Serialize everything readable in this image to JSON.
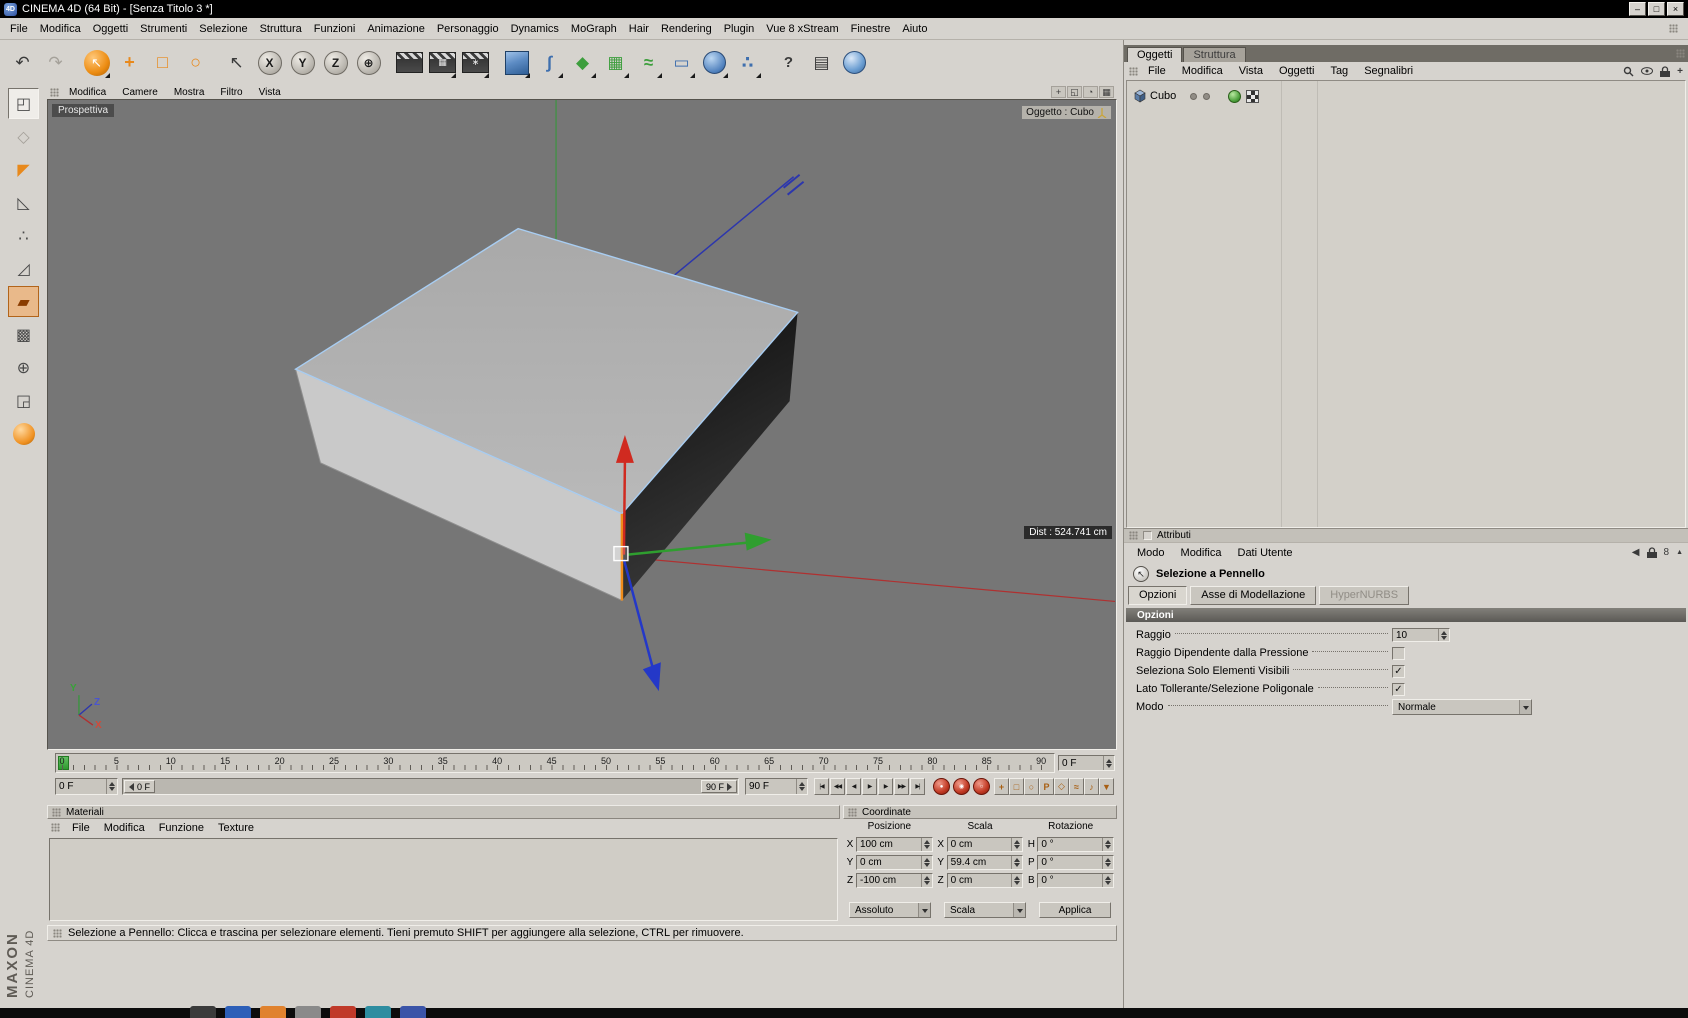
{
  "titlebar": {
    "app_badge": "4D",
    "title": "CINEMA 4D (64 Bit) - [Senza Titolo 3 *]",
    "min": "–",
    "max": "□",
    "close": "×"
  },
  "menubar": [
    "File",
    "Modifica",
    "Oggetti",
    "Strumenti",
    "Selezione",
    "Struttura",
    "Funzioni",
    "Animazione",
    "Personaggio",
    "Dynamics",
    "MoGraph",
    "Hair",
    "Rendering",
    "Plugin",
    "Vue 8 xStream",
    "Finestre",
    "Aiuto"
  ],
  "toolbar": [
    {
      "name": "undo-button",
      "glyph": "↶"
    },
    {
      "name": "redo-button",
      "glyph": "↷",
      "cls": "t-dim"
    },
    {
      "sep": true
    },
    {
      "name": "live-selection-tool",
      "glyph": "↖",
      "cls": "t-circle",
      "dd": true
    },
    {
      "name": "move-tool",
      "glyph": "+",
      "cls": "t-orange"
    },
    {
      "name": "scale-tool",
      "glyph": "□",
      "cls": "t-orange"
    },
    {
      "name": "rotate-tool",
      "glyph": "○",
      "cls": "t-orange"
    },
    {
      "sep": true
    },
    {
      "name": "last-used-tool",
      "glyph": "↖"
    },
    {
      "name": "lock-x-axis-button",
      "glyph": "X",
      "cls": "t-axis"
    },
    {
      "name": "lock-y-axis-button",
      "glyph": "Y",
      "cls": "t-axis"
    },
    {
      "name": "lock-z-axis-button",
      "glyph": "Z",
      "cls": "t-axis"
    },
    {
      "name": "coordinate-system-button",
      "glyph": "⊕",
      "cls": "t-axis"
    },
    {
      "sep": true
    },
    {
      "name": "render-view-button",
      "glyph": "",
      "cls": "t-clap"
    },
    {
      "name": "render-picture-viewer-button",
      "glyph": "▦",
      "cls": "t-clap",
      "dd": true
    },
    {
      "name": "render-settings-button",
      "glyph": "∗",
      "cls": "t-clap",
      "dd": true
    },
    {
      "sep": true
    },
    {
      "name": "add-cube-button",
      "glyph": "",
      "cls": "t-cube",
      "dd": true
    },
    {
      "name": "add-spline-button",
      "glyph": "∫",
      "cls": "t-blue",
      "dd": true
    },
    {
      "name": "add-nurbs-button",
      "glyph": "◆",
      "cls": "t-green",
      "dd": true
    },
    {
      "name": "add-modeling-object-button",
      "glyph": "▦",
      "cls": "t-green",
      "dd": true
    },
    {
      "name": "add-deformer-button",
      "glyph": "≈",
      "cls": "t-green",
      "dd": true
    },
    {
      "name": "add-scene-object-button",
      "glyph": "▭",
      "cls": "t-blue",
      "dd": true
    },
    {
      "name": "add-environment-button",
      "glyph": "",
      "cls": "t-ball",
      "dd": true
    },
    {
      "name": "add-particles-button",
      "glyph": "∴",
      "cls": "t-blue",
      "dd": true
    },
    {
      "sep": true
    },
    {
      "name": "help-button",
      "glyph": "?",
      "cls": "t-help"
    },
    {
      "name": "edit-layout-button",
      "glyph": "▤"
    },
    {
      "name": "online-help-button",
      "glyph": "",
      "cls": "t-globe"
    }
  ],
  "left_toolbar": [
    {
      "name": "make-editable-button",
      "glyph": "◰",
      "cls": "l-active"
    },
    {
      "name": "model-mode-button",
      "glyph": "◇",
      "cls": "l-dim"
    },
    {
      "name": "texture-axis-mode-button",
      "glyph": "◤",
      "cls": "l-orange"
    },
    {
      "name": "workplane-mode-button",
      "glyph": "◺"
    },
    {
      "name": "points-mode-button",
      "glyph": "∴"
    },
    {
      "name": "edges-mode-button",
      "glyph": "◿"
    },
    {
      "name": "polygons-mode-button",
      "glyph": "▰",
      "cls": "l-poly"
    },
    {
      "name": "texture-mode-button",
      "glyph": "▩"
    },
    {
      "name": "object-axis-mode-button",
      "glyph": "⊕"
    },
    {
      "name": "uv-mode-button",
      "glyph": "◲"
    },
    {
      "name": "render-region-button",
      "glyph": "",
      "cls": "l-ball"
    }
  ],
  "viewport": {
    "menu": [
      "Modifica",
      "Camere",
      "Mostra",
      "Filtro",
      "Vista"
    ],
    "nav_icons": [
      {
        "name": "view-pan-icon",
        "glyph": "+"
      },
      {
        "name": "view-zoom-icon",
        "glyph": "◱"
      },
      {
        "name": "view-rotate-icon",
        "glyph": "◔"
      },
      {
        "name": "view-switch-icon",
        "glyph": "▦"
      }
    ],
    "view_label": "Prospettiva",
    "object_label": "Oggetto : Cubo",
    "dist_label": "Dist : 524.741 cm",
    "axis": {
      "x": "X",
      "y": "Y",
      "z": "Z"
    }
  },
  "timeline": {
    "ticks": [
      0,
      5,
      10,
      15,
      20,
      25,
      30,
      35,
      40,
      45,
      50,
      55,
      60,
      65,
      70,
      75,
      80,
      85,
      90
    ],
    "frame_field": "0 F",
    "range_start": "0 F",
    "range_end": "90 F",
    "slider_start": "0 F",
    "slider_end": "90 F",
    "playback": [
      {
        "name": "goto-start-button",
        "glyph": "|◀"
      },
      {
        "name": "previous-key-button",
        "glyph": "◀◀"
      },
      {
        "name": "previous-frame-button",
        "glyph": "◀"
      },
      {
        "name": "play-button",
        "glyph": "▶"
      },
      {
        "name": "next-frame-button",
        "glyph": "▶"
      },
      {
        "name": "next-key-button",
        "glyph": "▶▶"
      },
      {
        "name": "goto-end-button",
        "glyph": "▶|"
      }
    ],
    "records": [
      {
        "name": "record-keyframe-button",
        "glyph": "●"
      },
      {
        "name": "autokeying-button",
        "glyph": "◉"
      },
      {
        "name": "record-selection-button",
        "glyph": "○"
      }
    ],
    "toggles": [
      {
        "name": "key-position-toggle",
        "glyph": "+"
      },
      {
        "name": "key-scale-toggle",
        "glyph": "□"
      },
      {
        "name": "key-rotation-toggle",
        "glyph": "○"
      },
      {
        "name": "key-parameter-toggle",
        "glyph": "P"
      },
      {
        "name": "key-pla-toggle",
        "glyph": "◇"
      },
      {
        "name": "keyframe-selection-toggle",
        "glyph": "≈"
      },
      {
        "name": "timeline-sound-toggle",
        "glyph": "♪"
      },
      {
        "name": "timeline-options-button",
        "glyph": "▼"
      }
    ]
  },
  "materials": {
    "title": "Materiali",
    "menu": [
      "File",
      "Modifica",
      "Funzione",
      "Texture"
    ]
  },
  "coordinates": {
    "title": "Coordinate",
    "cols": [
      {
        "key": "posizione",
        "header": "Posizione",
        "rows": [
          {
            "l": "X",
            "v": "100 cm"
          },
          {
            "l": "Y",
            "v": "0 cm"
          },
          {
            "l": "Z",
            "v": "-100 cm"
          }
        ]
      },
      {
        "key": "scala",
        "header": "Scala",
        "rows": [
          {
            "l": "X",
            "v": "0 cm"
          },
          {
            "l": "Y",
            "v": "59.4 cm"
          },
          {
            "l": "Z",
            "v": "0 cm"
          }
        ]
      },
      {
        "key": "rotazione",
        "header": "Rotazione",
        "rows": [
          {
            "l": "H",
            "v": "0 °"
          },
          {
            "l": "P",
            "v": "0 °"
          },
          {
            "l": "B",
            "v": "0 °"
          }
        ]
      }
    ],
    "mode_select": "Assoluto",
    "scale_select": "Scala",
    "apply": "Applica"
  },
  "statusbar": {
    "text": "Selezione a Pennello: Clicca e trascina per selezionare elementi. Tieni premuto SHIFT per aggiungere alla selezione, CTRL per rimuovere."
  },
  "object_manager": {
    "tabs": [
      {
        "label": "Oggetti",
        "active": true
      },
      {
        "label": "Struttura",
        "active": false
      }
    ],
    "menu": [
      "File",
      "Modifica",
      "Vista",
      "Oggetti",
      "Tag",
      "Segnalibri"
    ],
    "object": {
      "name": "Cubo"
    }
  },
  "attributes": {
    "panel_title": "Attributi",
    "menu": [
      "Modo",
      "Modifica",
      "Dati Utente"
    ],
    "history_back_glyph": "◀",
    "compare_glyph": "8",
    "fold_glyph": "▲",
    "tool_title": "Selezione a Pennello",
    "tabs": [
      {
        "label": "Opzioni"
      },
      {
        "label": "Asse di Modellazione"
      },
      {
        "label": "HyperNURBS"
      }
    ],
    "section_title": "Opzioni",
    "raggio_label": "Raggio",
    "raggio_value": "10",
    "pressure_label": "Raggio Dipendente dalla Pressione",
    "pressure_checked": "",
    "visible_label": "Seleziona Solo Elementi Visibili",
    "visible_checked": "✓",
    "tolerant_label": "Lato Tollerante/Selezione Poligonale",
    "tolerant_checked": "✓",
    "modo_label": "Modo",
    "modo_value": "Normale"
  },
  "branding": {
    "maxon": "MAXON",
    "product": "CINEMA 4D"
  },
  "accent_colors": {
    "orange": "#e8891c",
    "axis_x": "#d02a20",
    "axis_y": "#2f9e2f",
    "axis_z": "#2438c8",
    "selection_edge": "#a8cdf2"
  },
  "taskbar": {
    "icons": [
      {
        "name": "taskbar-item-1",
        "color": "#3b3b3b"
      },
      {
        "name": "taskbar-item-2",
        "color": "#2d5fb8"
      },
      {
        "name": "taskbar-item-3",
        "color": "#e0822e"
      },
      {
        "name": "taskbar-item-4",
        "color": "#8a8a8a"
      },
      {
        "name": "taskbar-item-5",
        "color": "#c03a2a"
      },
      {
        "name": "taskbar-item-6",
        "color": "#2e8da0"
      },
      {
        "name": "taskbar-item-7",
        "color": "#3b54a8"
      }
    ]
  }
}
